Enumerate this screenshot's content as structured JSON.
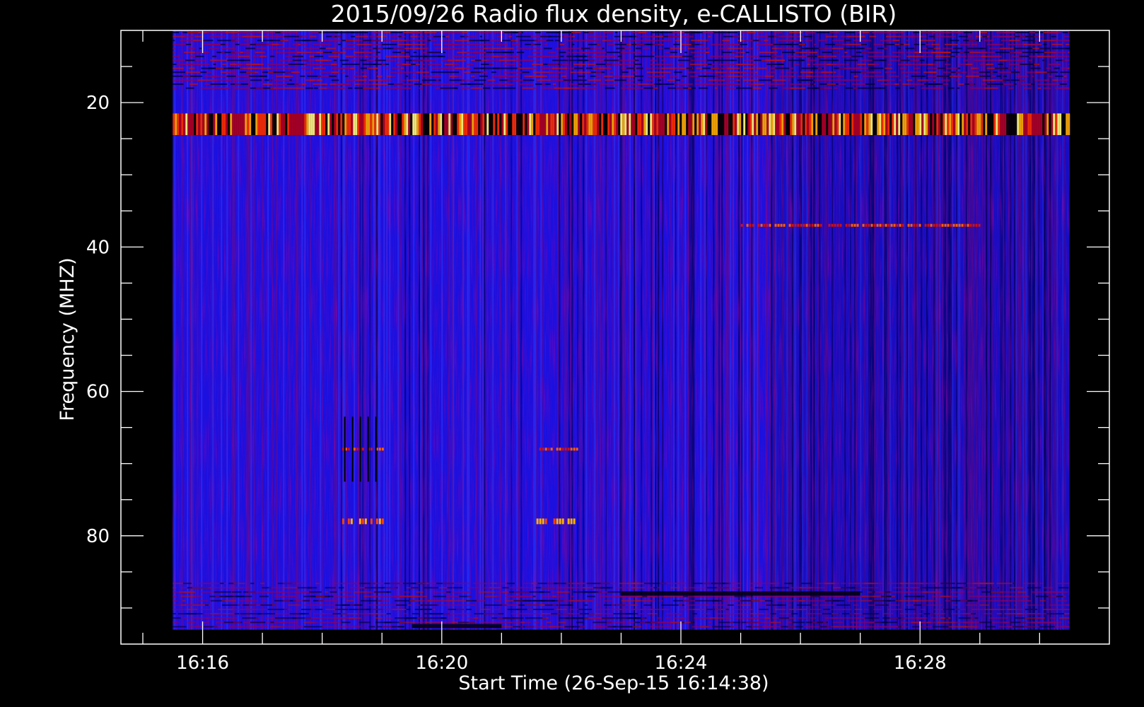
{
  "chart_data": {
    "type": "heatmap",
    "title": "2015/09/26  Radio flux density, e-CALLISTO (BIR)",
    "xlabel": "Start Time (26-Sep-15 16:14:38)",
    "ylabel": "Frequency (MHZ)",
    "y_axis_inverted": true,
    "xlim": [
      "16:14:38",
      "16:31:10"
    ],
    "ylim": [
      10,
      95
    ],
    "data_extent": {
      "time": [
        "16:15:30",
        "16:30:30"
      ],
      "frequency_mhz": [
        10,
        93
      ]
    },
    "x_ticks": [
      "16:16",
      "16:20",
      "16:24",
      "16:28"
    ],
    "y_ticks": [
      "20",
      "40",
      "60",
      "80"
    ],
    "colormap": [
      "#000000",
      "#1010ff",
      "#8a0060",
      "#e02000",
      "#ffc000",
      "#ffffff"
    ],
    "background_color": "#1a10e0",
    "features": [
      {
        "kind": "rfi_band",
        "frequency_mhz": [
          21.5,
          24.5
        ],
        "time": [
          "16:15:30",
          "16:30:30"
        ],
        "intensity": "high"
      },
      {
        "kind": "narrow_band",
        "frequency_mhz": 78,
        "time": [
          "16:18:20",
          "16:19:00"
        ],
        "intensity": "high"
      },
      {
        "kind": "narrow_band",
        "frequency_mhz": 78,
        "time": [
          "16:21:35",
          "16:22:15"
        ],
        "intensity": "high"
      },
      {
        "kind": "narrow_band",
        "frequency_mhz": 68,
        "time": [
          "16:18:20",
          "16:19:00"
        ],
        "intensity": "medium"
      },
      {
        "kind": "narrow_band",
        "frequency_mhz": 68,
        "time": [
          "16:21:35",
          "16:22:15"
        ],
        "intensity": "medium"
      },
      {
        "kind": "narrow_band",
        "frequency_mhz": 37,
        "time": [
          "16:25:00",
          "16:29:00"
        ],
        "intensity": "medium"
      },
      {
        "kind": "dark_band",
        "frequency_mhz": 88,
        "time": [
          "16:23:00",
          "16:27:00"
        ],
        "intensity": "low"
      },
      {
        "kind": "dark_band",
        "frequency_mhz": 92.5,
        "time": [
          "16:19:30",
          "16:21:00"
        ],
        "intensity": "low"
      }
    ]
  }
}
